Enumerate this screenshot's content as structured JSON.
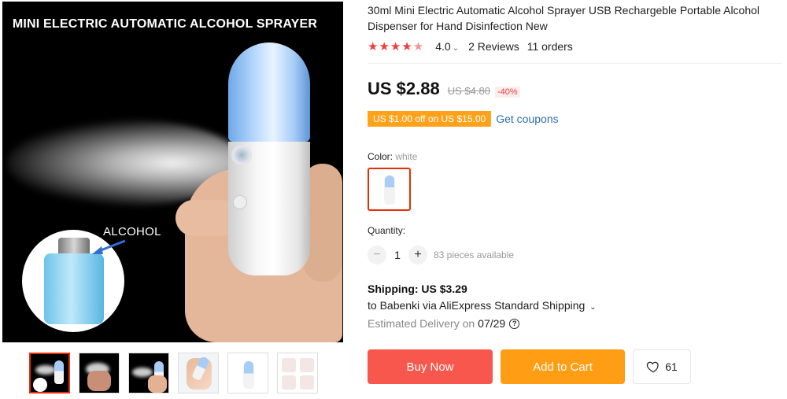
{
  "gallery": {
    "banner_text": "MINI ELECTRIC AUTOMATIC ALCOHOL SPRAYER",
    "alcohol_label": "ALCOHOL",
    "thumbnail_count": 6,
    "active_thumbnail_index": 0
  },
  "product": {
    "title": "30ml Mini Electric Automatic Alcohol Sprayer USB Rechargeble Portable Alcohol Dispenser for Hand Disinfection New",
    "rating": "4.0",
    "reviews": "2 Reviews",
    "orders": "11 orders",
    "stars_filled": 4
  },
  "price": {
    "current": "US $2.88",
    "original": "US $4.80",
    "discount": "-40%"
  },
  "coupon": {
    "text": "US $1.00 off on US $15.00",
    "link": "Get coupons"
  },
  "color": {
    "label": "Color:",
    "value": "white"
  },
  "quantity": {
    "label": "Quantity:",
    "minus": "−",
    "plus": "+",
    "value": "1",
    "available": "83 pieces available"
  },
  "shipping": {
    "title": "Shipping: US $3.29",
    "line": "to Babenki via AliExpress Standard Shipping",
    "delivery_label": "Estimated Delivery on",
    "delivery_date": "07/29"
  },
  "actions": {
    "buy_now": "Buy Now",
    "add_to_cart": "Add to Cart",
    "wishlist_count": "61"
  },
  "colors": {
    "price_red": "#f03c3c",
    "buy_now_bg": "#f7574d",
    "add_to_cart_bg": "#ff9d14",
    "coupon_bg": "#ffa21a",
    "link_blue": "#2e6db4",
    "active_border": "#e62e04"
  }
}
